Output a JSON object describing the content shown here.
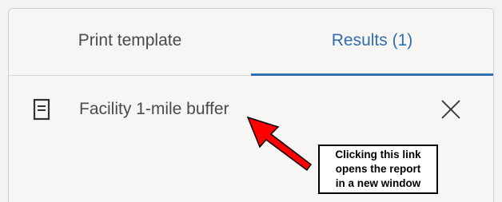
{
  "tabs": [
    {
      "label": "Print template",
      "active": false
    },
    {
      "label": "Results (1)",
      "active": true
    }
  ],
  "results": [
    {
      "label": "Facility 1-mile buffer",
      "icon": "document-icon"
    }
  ],
  "annotation": {
    "lines": [
      "Clicking this link",
      "opens the report",
      "in a new window"
    ],
    "arrow_color": "#ff0000"
  },
  "colors": {
    "accent": "#2f6fb0",
    "text": "#4a4a4a"
  }
}
